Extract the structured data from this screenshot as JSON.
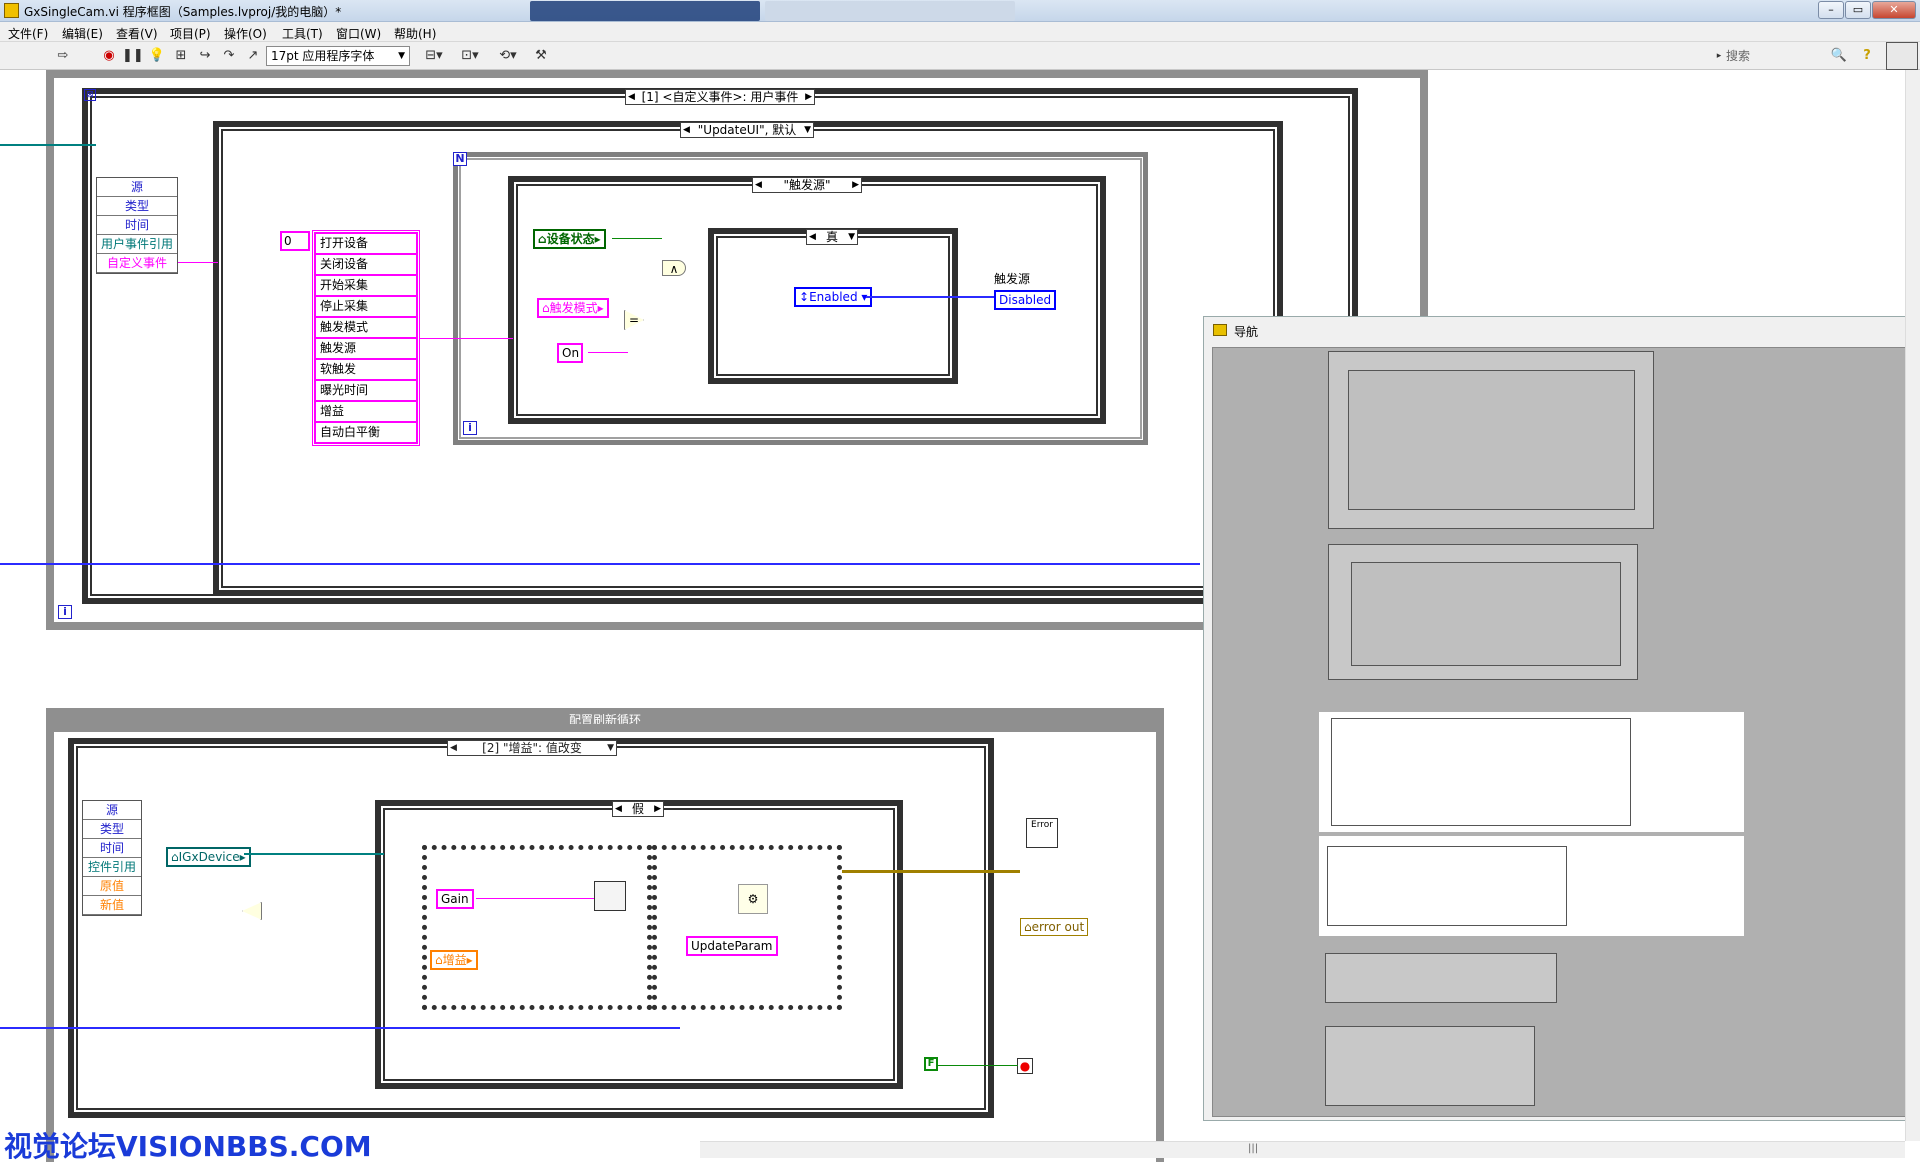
{
  "window": {
    "title": "GxSingleCam.vi 程序框图（Samples.lvproj/我的电脑）*",
    "controls": [
      "–",
      "▭",
      "✕"
    ]
  },
  "menu": [
    "文件(F)",
    "编辑(E)",
    "查看(V)",
    "项目(P)",
    "操作(O)",
    "工具(T)",
    "窗口(W)",
    "帮助(H)"
  ],
  "toolbar": {
    "font": "17pt 应用程序字体",
    "search_placeholder": "搜索",
    "help": "?"
  },
  "event_loop": {
    "event_selector": "[1] <自定义事件>: 用户事件",
    "case_selector": "\"UpdateUI\", 默认",
    "event_data": [
      "源",
      "类型",
      "时间",
      "用户事件引用",
      "自定义事件"
    ],
    "index_const": "0",
    "case_items": [
      "打开设备",
      "关闭设备",
      "开始采集",
      "停止采集",
      "触发模式",
      "触发源",
      "软触发",
      "曝光时间",
      "增益",
      "自动白平衡"
    ],
    "for_n": "N",
    "for_i": "i",
    "inner_case": "\"触发源\"",
    "true_case": "真",
    "device_state": "设备状态",
    "trigger_mode": "触发模式",
    "on_const": "On",
    "and_op": "∧",
    "eq_op": "=",
    "enabled": "Enabled",
    "trigger_source_label": "触发源",
    "disabled": "Disabled",
    "loop_i": "i"
  },
  "config_loop": {
    "title": "配置刷新循环",
    "event_selector": "[2] \"增益\": 值改变",
    "event_data": [
      "源",
      "类型",
      "时间",
      "控件引用",
      "原值",
      "新值"
    ],
    "false_case": "假",
    "igx": "IGxDevice",
    "gain": "Gain",
    "gain_cn": "增益",
    "update_param": "UpdateParam",
    "error_out": "error out",
    "error_icon": "Error",
    "false_const": "F"
  },
  "nav": {
    "title": "导航"
  },
  "watermark": "视觉论坛VISIONBBS.COM",
  "status": "|||"
}
